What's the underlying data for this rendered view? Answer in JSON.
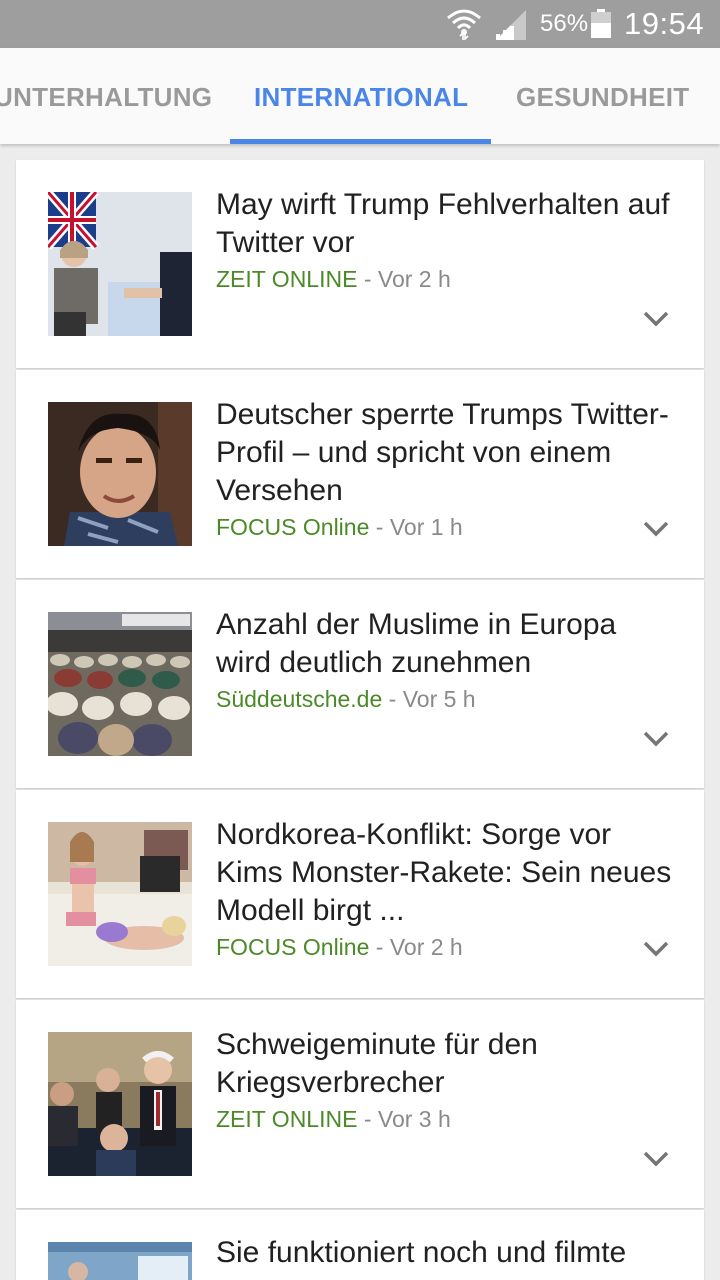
{
  "status_bar": {
    "battery_percent": "56%",
    "time": "19:54"
  },
  "tabs": [
    {
      "label": "UNTERHALTUNG",
      "selected": false
    },
    {
      "label": "INTERNATIONAL",
      "selected": true
    },
    {
      "label": "GESUNDHEIT",
      "selected": false
    }
  ],
  "colors": {
    "accent": "#4a86e8",
    "source_green": "#4c8a27",
    "status_bar": "#9e9e9e"
  },
  "articles": [
    {
      "title": "May wirft Trump Fehlverhalten auf Twitter vor",
      "source": "ZEIT ONLINE",
      "time": "Vor 2 h"
    },
    {
      "title": "Deutscher sperrte Trumps Twitter-Profil – und spricht von einem Versehen",
      "source": "FOCUS Online",
      "time": "Vor 1 h"
    },
    {
      "title": "Anzahl der Muslime in Europa wird deutlich zunehmen",
      "source": "Süddeutsche.de",
      "time": "Vor 5 h"
    },
    {
      "title": "Nordkorea-Konflikt: Sorge vor Kims Monster-Rakete: Sein neues Modell birgt ...",
      "source": "FOCUS Online",
      "time": "Vor 2 h"
    },
    {
      "title": "Schweigeminute für den Kriegsverbrecher",
      "source": "ZEIT ONLINE",
      "time": "Vor 3 h"
    },
    {
      "title": "Sie funktioniert noch und filmte"
    }
  ],
  "meta_separator": " - "
}
